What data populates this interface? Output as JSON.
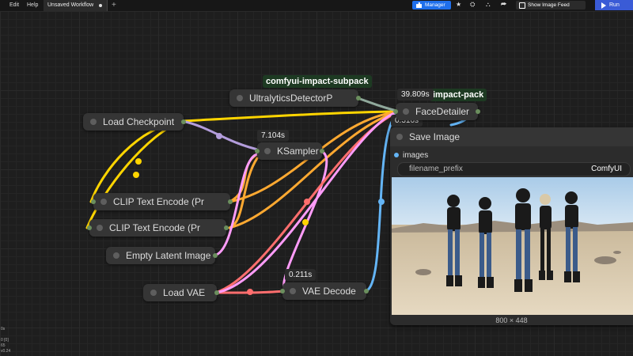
{
  "menu": {
    "edit": "Edit",
    "help": "Help"
  },
  "tab": {
    "title": "Unsaved Workflow",
    "add": "+"
  },
  "toolbar": {
    "manager": "Manager",
    "feed": "Show Image Feed",
    "run": "Run",
    "star": "★",
    "share": "⮫"
  },
  "badges": {
    "subpack": "comfyui-impact-subpack",
    "impactpack": "impact-pack",
    "time_facedetailer": "39.809s",
    "time_facedetailer2": "0.310s",
    "time_ksampler": "7.104s",
    "time_vaedecode": "0.211s"
  },
  "nodes": {
    "load_checkpoint": "Load Checkpoint",
    "ultralytics": "UltralyticsDetectorP",
    "facedetailer": "FaceDetailer",
    "ksampler": "KSampler",
    "clip1": "CLIP Text Encode (Pr",
    "clip2": "CLIP Text Encode (Pr",
    "empty_latent": "Empty Latent Image",
    "load_vae": "Load VAE",
    "vae_decode": "VAE Decode"
  },
  "save_image": {
    "title": "Save Image",
    "images_label": "images",
    "filename_prefix_label": "filename_prefix",
    "filename_prefix_value": "ComfyUI",
    "dimensions": "800 × 448"
  },
  "stats": {
    "l1": "0s",
    "l2": "0 [0]",
    "l3": "65",
    "l4": "v0.24"
  },
  "colors": {
    "model": "#b39ddb",
    "clip": "#ffd500",
    "conditioning": "#ffa931",
    "latent": "#ff9cf9",
    "vae": "#ff6e6e",
    "image": "#64b5f6",
    "accent": "#1f6feb"
  }
}
